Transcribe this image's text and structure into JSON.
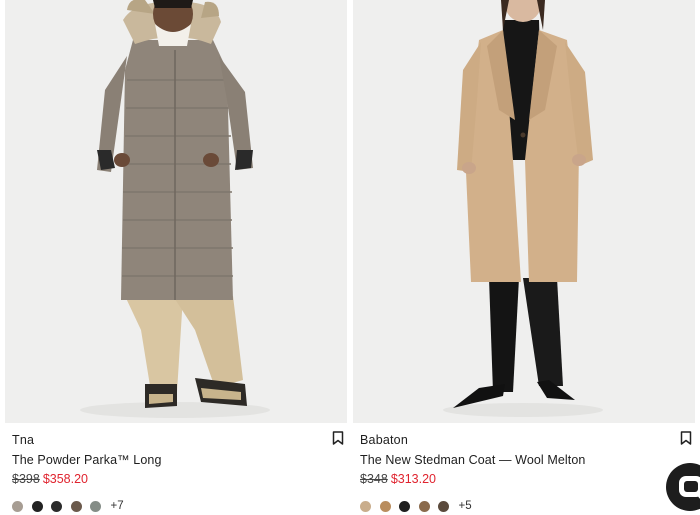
{
  "products": [
    {
      "brand": "Tna",
      "name": "The Powder Parka™ Long",
      "price_original": "$398",
      "price_sale": "$358.20",
      "swatch_colors": [
        "#a79d93",
        "#222222",
        "#2b2b2b",
        "#6b5a4c",
        "#858d87"
      ],
      "more_colors": "+7",
      "bookmark_icon": "bookmark-icon"
    },
    {
      "brand": "Babaton",
      "name": "The New Stedman Coat — Wool Melton",
      "price_original": "$348",
      "price_sale": "$313.20",
      "swatch_colors": [
        "#c9ad8c",
        "#b98d5e",
        "#1f1f1f",
        "#8a6a4c",
        "#5b4a3c"
      ],
      "more_colors": "+5",
      "bookmark_icon": "bookmark-icon"
    }
  ],
  "chat": {
    "icon": "chat-bubble-icon"
  },
  "colors": {
    "sale_price": "#e0242f",
    "photo_background": "#efefee"
  }
}
